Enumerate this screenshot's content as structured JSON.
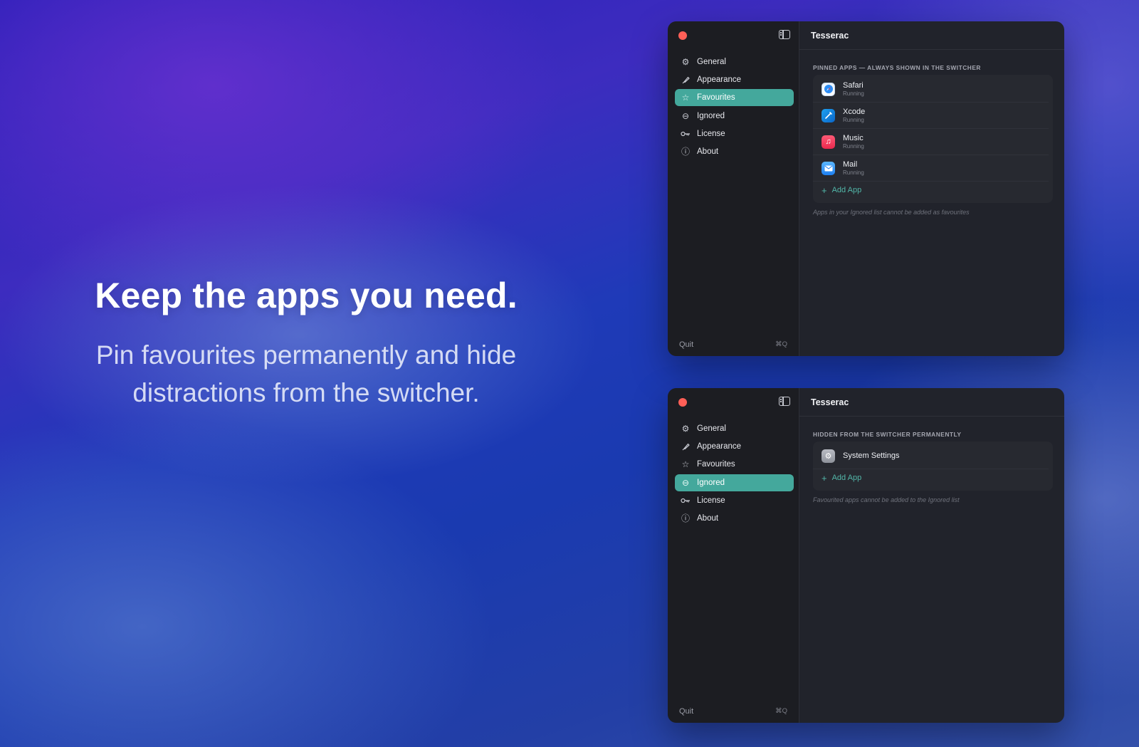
{
  "hero": {
    "title": "Keep the apps you need.",
    "subtitle": "Pin favourites permanently and hide distractions from the switcher."
  },
  "windows": [
    {
      "title": "Tesserac",
      "nav": [
        {
          "label": "General",
          "icon": "gear-icon"
        },
        {
          "label": "Appearance",
          "icon": "brush-icon"
        },
        {
          "label": "Favourites",
          "icon": "star-icon",
          "active": true
        },
        {
          "label": "Ignored",
          "icon": "minus-circle-icon"
        },
        {
          "label": "License",
          "icon": "key-icon"
        },
        {
          "label": "About",
          "icon": "info-icon"
        }
      ],
      "quit_label": "Quit",
      "quit_shortcut": "⌘Q",
      "section_title": "PINNED APPS — ALWAYS SHOWN IN THE SWITCHER",
      "apps": [
        {
          "name": "Safari",
          "status": "Running"
        },
        {
          "name": "Xcode",
          "status": "Running"
        },
        {
          "name": "Music",
          "status": "Running"
        },
        {
          "name": "Mail",
          "status": "Running"
        }
      ],
      "add_label": "Add App",
      "note": "Apps in your Ignored list cannot be added as favourites"
    },
    {
      "title": "Tesserac",
      "nav": [
        {
          "label": "General",
          "icon": "gear-icon"
        },
        {
          "label": "Appearance",
          "icon": "brush-icon"
        },
        {
          "label": "Favourites",
          "icon": "star-icon"
        },
        {
          "label": "Ignored",
          "icon": "minus-circle-icon",
          "active": true
        },
        {
          "label": "License",
          "icon": "key-icon"
        },
        {
          "label": "About",
          "icon": "info-icon"
        }
      ],
      "quit_label": "Quit",
      "quit_shortcut": "⌘Q",
      "section_title": "HIDDEN FROM THE SWITCHER PERMANENTLY",
      "apps": [
        {
          "name": "System Settings"
        }
      ],
      "add_label": "Add App",
      "note": "Favourited apps cannot be added to the Ignored list"
    }
  ],
  "colors": {
    "accent": "#44a89c",
    "add_link": "#52b6a8",
    "close_dot": "#ff5f57",
    "window_bg": "#21232b",
    "sidebar_bg": "#1c1d22"
  }
}
